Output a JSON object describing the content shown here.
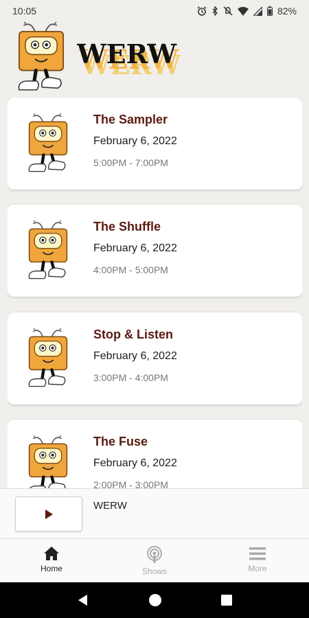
{
  "status_bar": {
    "time": "10:05",
    "battery": "82%"
  },
  "header": {
    "station_logo_text": "WERW"
  },
  "shows": [
    {
      "title": "The Sampler",
      "date": "February 6, 2022",
      "time": "5:00PM - 7:00PM"
    },
    {
      "title": "The Shuffle",
      "date": "February 6, 2022",
      "time": "4:00PM - 5:00PM"
    },
    {
      "title": "Stop & Listen",
      "date": "February 6, 2022",
      "time": "3:00PM - 4:00PM"
    },
    {
      "title": "The Fuse",
      "date": "February 6, 2022",
      "time": "2:00PM - 3:00PM"
    }
  ],
  "player": {
    "station": "WERW"
  },
  "bottom_nav": {
    "home": "Home",
    "shows": "Shows",
    "more": "More"
  },
  "colors": {
    "accent": "#5a1a10",
    "mascot": "#f0a63c",
    "background": "#f1efec"
  }
}
